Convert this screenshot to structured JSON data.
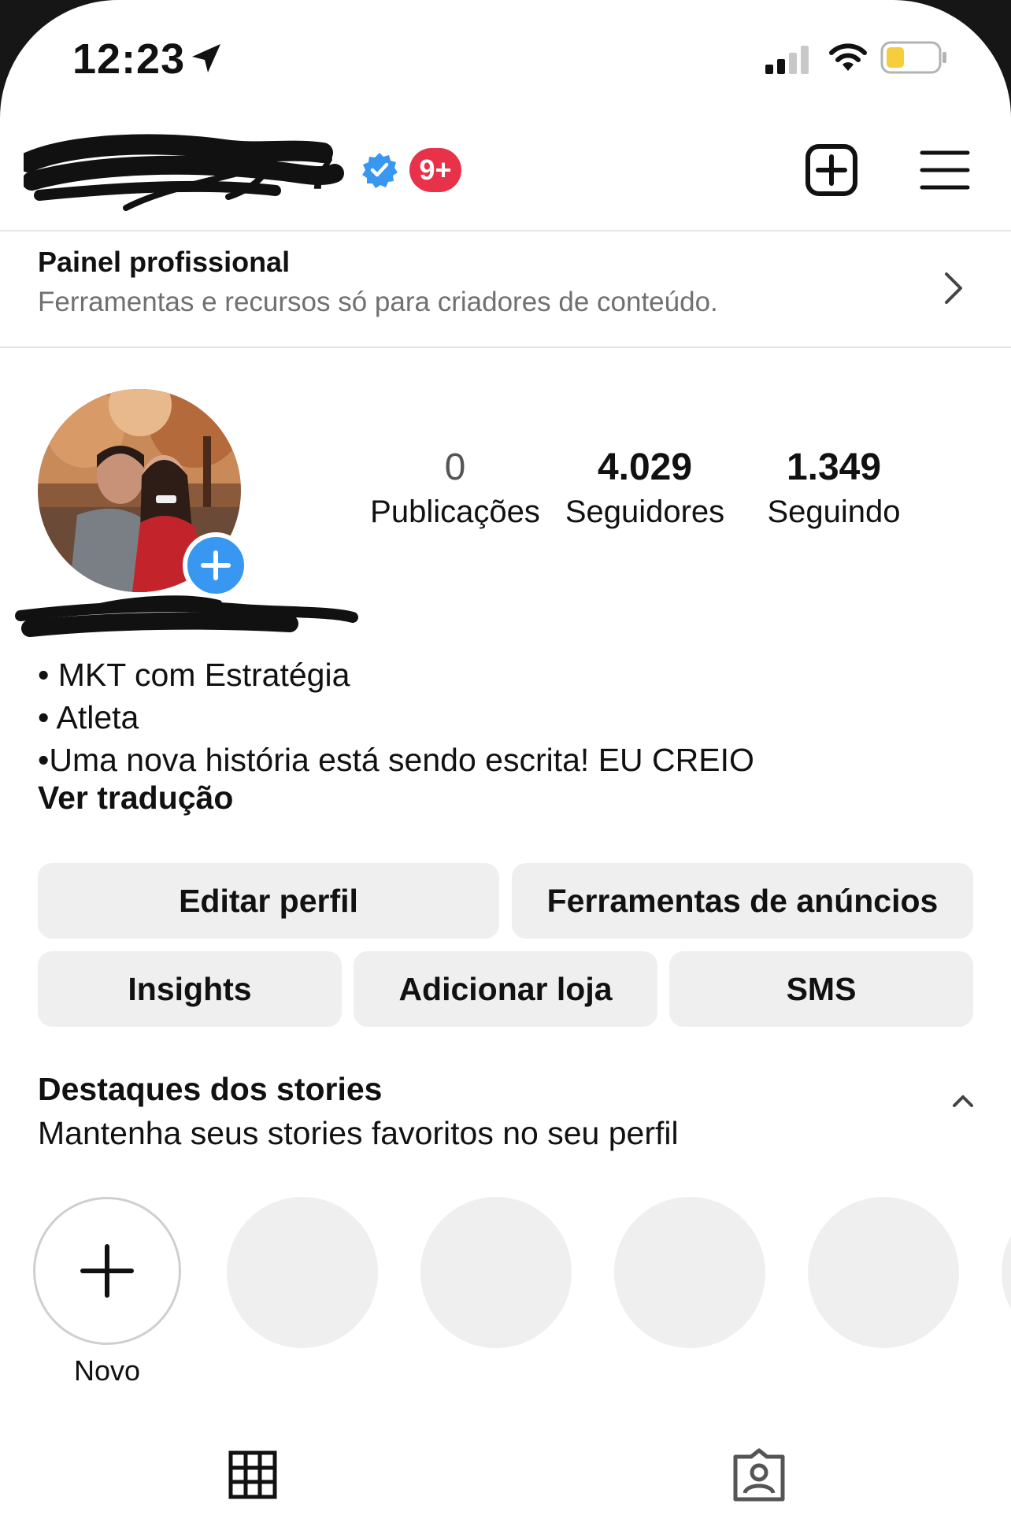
{
  "status_bar": {
    "time": "12:23",
    "icons": [
      "location-arrow-icon",
      "cellular-signal-icon",
      "wifi-icon",
      "battery-low-icon"
    ]
  },
  "header": {
    "username_icon": "redacted-scribble",
    "notification_badge": "9+",
    "icons": [
      "verified-badge-icon",
      "new-post-icon",
      "hamburger-menu-icon"
    ]
  },
  "professional_dashboard": {
    "title": "Painel profissional",
    "subtitle": "Ferramentas e recursos só para criadores de conteúdo."
  },
  "profile": {
    "stats": [
      {
        "value": "0",
        "label": "Publicações"
      },
      {
        "value": "4.029",
        "label": "Seguidores"
      },
      {
        "value": "1.349",
        "label": "Seguindo"
      }
    ],
    "bio": [
      "• MKT com Estratégia",
      "• Atleta",
      "•Uma nova história está sendo escrita! EU CREIO"
    ],
    "see_translation": "Ver tradução"
  },
  "buttons": {
    "edit_profile": "Editar perfil",
    "ad_tools": "Ferramentas de anúncios",
    "insights": "Insights",
    "add_shop": "Adicionar loja",
    "sms": "SMS"
  },
  "highlights": {
    "title": "Destaques dos stories",
    "subtitle": "Mantenha seus stories favoritos no seu perfil",
    "new_label": "Novo"
  },
  "tabs": [
    "grid-icon",
    "tagged-icon"
  ],
  "colors": {
    "accent_blue": "#3897f0",
    "badge_red": "#e8324a",
    "button_gray": "#efefef",
    "battery_yellow": "#f6cd3b"
  }
}
